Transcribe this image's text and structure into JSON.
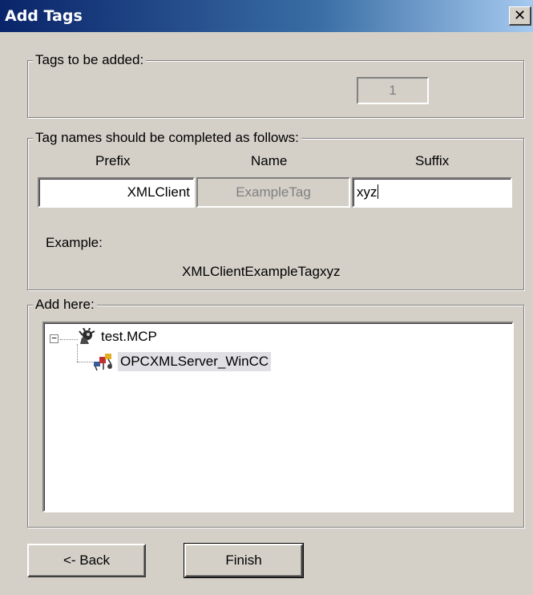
{
  "window": {
    "title": "Add Tags",
    "close_glyph": "✕"
  },
  "tags_to_add": {
    "legend": "Tags to be added:",
    "count": "1"
  },
  "names": {
    "legend": "Tag names should be completed as follows:",
    "prefix_header": "Prefix",
    "name_header": "Name",
    "suffix_header": "Suffix",
    "prefix_value": "XMLClient",
    "name_value": "ExampleTag",
    "suffix_value": "xyz",
    "example_label": "Example:",
    "example_value": "XMLClientExampleTagxyz"
  },
  "add_here": {
    "legend": "Add here:",
    "tree": [
      {
        "label": "test.MCP",
        "icon": "project-icon",
        "expanded": true
      },
      {
        "label": "OPCXMLServer_WinCC",
        "icon": "opc-server-icon",
        "selected": true
      }
    ]
  },
  "buttons": {
    "back": "<- Back",
    "finish": "Finish"
  }
}
